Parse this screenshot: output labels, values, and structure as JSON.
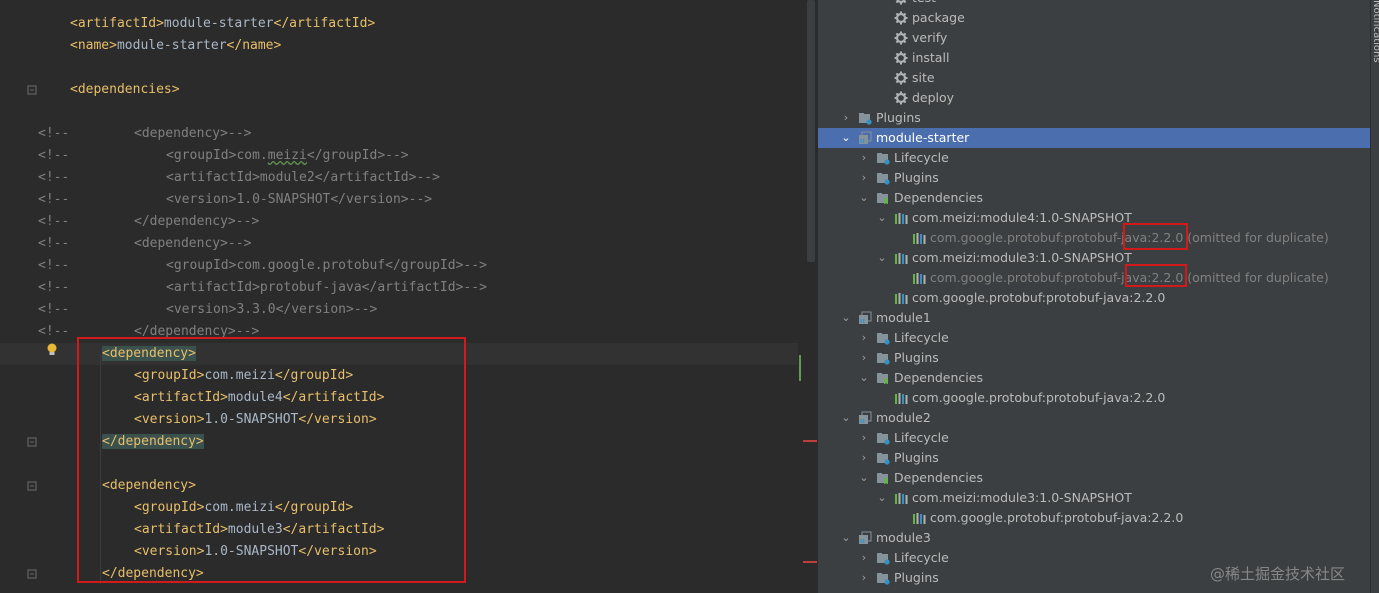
{
  "editor": {
    "lines": [
      {
        "parts": [
          [
            "t",
            "<artifactId>"
          ],
          [
            "tx",
            "module-starter"
          ],
          [
            "t",
            "</artifactId>"
          ]
        ]
      },
      {
        "parts": [
          [
            "t",
            "<name>"
          ],
          [
            "tx",
            "module-starter"
          ],
          [
            "t",
            "</name>"
          ]
        ]
      },
      {
        "parts": []
      },
      {
        "parts": [
          [
            "t",
            "<dependencies>"
          ]
        ]
      },
      {
        "parts": []
      },
      {
        "comment": "<!--",
        "parts": [
          [
            "cm",
            "<dependency>-->"
          ]
        ]
      },
      {
        "comment": "<!--",
        "parts": [
          [
            "cm",
            "<groupId>com."
          ],
          [
            "cm",
            "meizi"
          ],
          [
            "cm",
            "</groupId>-->"
          ]
        ]
      },
      {
        "comment": "<!--",
        "parts": [
          [
            "cm",
            "<artifactId>module2</artifactId>-->"
          ]
        ]
      },
      {
        "comment": "<!--",
        "parts": [
          [
            "cm",
            "<version>1.0-SNAPSHOT</version>-->"
          ]
        ]
      },
      {
        "comment": "<!--",
        "parts": [
          [
            "cm",
            "</dependency>-->"
          ]
        ]
      },
      {
        "comment": "<!--",
        "parts": [
          [
            "cm",
            "<dependency>-->"
          ]
        ]
      },
      {
        "comment": "<!--",
        "parts": [
          [
            "cm",
            "<groupId>com.google.protobuf</groupId>-->"
          ]
        ]
      },
      {
        "comment": "<!--",
        "parts": [
          [
            "cm",
            "<artifactId>protobuf-java</artifactId>-->"
          ]
        ]
      },
      {
        "comment": "<!--",
        "parts": [
          [
            "cm",
            "<version>3.3.0</version>-->"
          ]
        ]
      },
      {
        "comment": "<!--",
        "parts": [
          [
            "cm",
            "</dependency>-->"
          ]
        ]
      },
      {
        "parts": [
          [
            "t",
            "<dependency>"
          ]
        ]
      },
      {
        "parts": [
          [
            "t",
            "<groupId>"
          ],
          [
            "tx",
            "com.meizi"
          ],
          [
            "t",
            "</groupId>"
          ]
        ]
      },
      {
        "parts": [
          [
            "t",
            "<artifactId>"
          ],
          [
            "tx",
            "module4"
          ],
          [
            "t",
            "</artifactId>"
          ]
        ]
      },
      {
        "parts": [
          [
            "t",
            "<version>"
          ],
          [
            "tx",
            "1.0-SNAPSHOT"
          ],
          [
            "t",
            "</version>"
          ]
        ]
      },
      {
        "parts": [
          [
            "t",
            "</dependency>"
          ]
        ]
      },
      {
        "parts": []
      },
      {
        "parts": [
          [
            "t",
            "<dependency>"
          ]
        ]
      },
      {
        "parts": [
          [
            "t",
            "<groupId>"
          ],
          [
            "tx",
            "com.meizi"
          ],
          [
            "t",
            "</groupId>"
          ]
        ]
      },
      {
        "parts": [
          [
            "t",
            "<artifactId>"
          ],
          [
            "tx",
            "module3"
          ],
          [
            "t",
            "</artifactId>"
          ]
        ]
      },
      {
        "parts": [
          [
            "t",
            "<version>"
          ],
          [
            "tx",
            "1.0-SNAPSHOT"
          ],
          [
            "t",
            "</version>"
          ]
        ]
      },
      {
        "parts": [
          [
            "t",
            "</dependency>"
          ]
        ]
      }
    ]
  },
  "maven": {
    "nodes": [
      {
        "label": "test",
        "icon": "gear-icon"
      },
      {
        "label": "package",
        "icon": "gear-icon"
      },
      {
        "label": "verify",
        "icon": "gear-icon"
      },
      {
        "label": "install",
        "icon": "gear-icon"
      },
      {
        "label": "site",
        "icon": "gear-icon"
      },
      {
        "label": "deploy",
        "icon": "gear-icon"
      },
      {
        "label": "Plugins",
        "icon": "folder-gear-icon",
        "arrow": "›"
      },
      {
        "label": "module-starter",
        "icon": "module-icon",
        "arrow": "⌄",
        "selected": true
      },
      {
        "label": "Lifecycle",
        "icon": "folder-gear-icon",
        "arrow": "›"
      },
      {
        "label": "Plugins",
        "icon": "folder-gear-icon",
        "arrow": "›"
      },
      {
        "label": "Dependencies",
        "icon": "folder-lib-icon",
        "arrow": "⌄"
      },
      {
        "label": "com.meizi:module4:1.0-SNAPSHOT",
        "icon": "library-icon",
        "arrow": "⌄"
      },
      {
        "label": "com.google.protobuf:protobuf-java:2.2.0 (omitted for duplicate)",
        "icon": "library-icon",
        "gray": true
      },
      {
        "label": "com.meizi:module3:1.0-SNAPSHOT",
        "icon": "library-icon",
        "arrow": "⌄"
      },
      {
        "label": "com.google.protobuf:protobuf-java:2.2.0 (omitted for duplicate)",
        "icon": "library-icon",
        "gray": true
      },
      {
        "label": "com.google.protobuf:protobuf-java:2.2.0",
        "icon": "library-icon"
      },
      {
        "label": "module1",
        "icon": "module-icon",
        "arrow": "⌄"
      },
      {
        "label": "Lifecycle",
        "icon": "folder-gear-icon",
        "arrow": "›"
      },
      {
        "label": "Plugins",
        "icon": "folder-gear-icon",
        "arrow": "›"
      },
      {
        "label": "Dependencies",
        "icon": "folder-lib-icon",
        "arrow": "⌄"
      },
      {
        "label": "com.google.protobuf:protobuf-java:2.2.0",
        "icon": "library-icon"
      },
      {
        "label": "module2",
        "icon": "module-icon",
        "arrow": "⌄"
      },
      {
        "label": "Lifecycle",
        "icon": "folder-gear-icon",
        "arrow": "›"
      },
      {
        "label": "Plugins",
        "icon": "folder-gear-icon",
        "arrow": "›"
      },
      {
        "label": "Dependencies",
        "icon": "folder-lib-icon",
        "arrow": "⌄"
      },
      {
        "label": "com.meizi:module3:1.0-SNAPSHOT",
        "icon": "library-icon",
        "arrow": "⌄"
      },
      {
        "label": "com.google.protobuf:protobuf-java:2.2.0",
        "icon": "library-icon"
      },
      {
        "label": "module3",
        "icon": "module-icon",
        "arrow": "⌄"
      },
      {
        "label": "Lifecycle",
        "icon": "folder-gear-icon",
        "arrow": "›"
      },
      {
        "label": "Plugins",
        "icon": "folder-gear-icon",
        "arrow": "›"
      }
    ]
  },
  "right_strip": {
    "label": "Notifications"
  },
  "watermark": "@稀土掘金技术社区",
  "colors": {
    "highlight_box": "#d21a1a",
    "selection": "#4b6eaf",
    "tag": "#e8bf6a"
  }
}
